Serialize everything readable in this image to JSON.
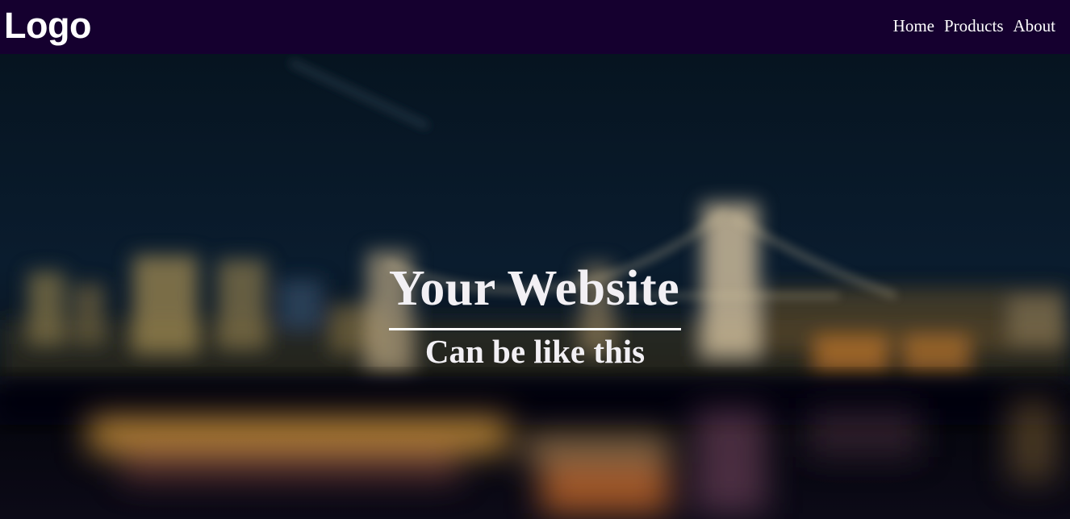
{
  "navbar": {
    "logo": "Logo",
    "links": [
      {
        "label": "Home"
      },
      {
        "label": "Products"
      },
      {
        "label": "About"
      }
    ],
    "background": "#15002f"
  },
  "hero": {
    "title": "Your Website",
    "subtitle": "Can be like this",
    "background_image": "blurred-night-city-bridge-skyline"
  }
}
